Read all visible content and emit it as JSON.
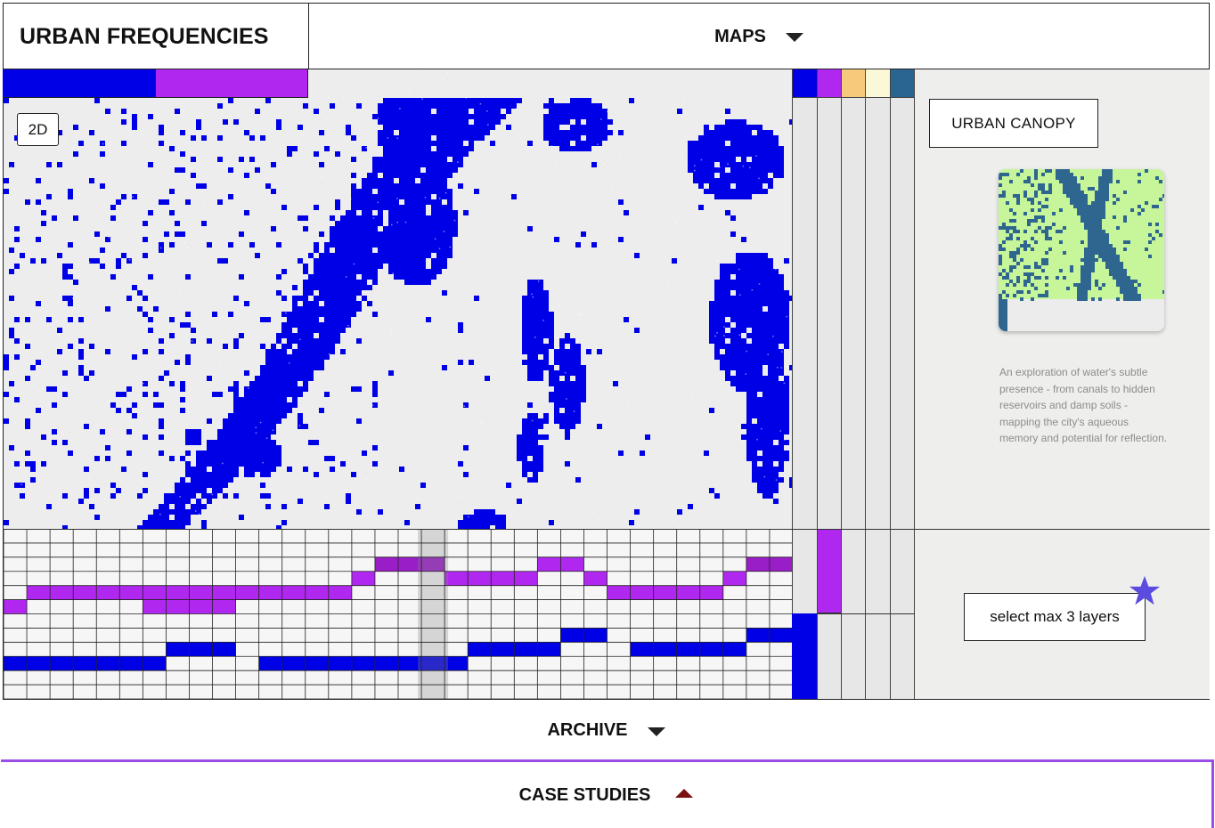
{
  "header": {
    "brand": "URBAN FREQUENCIES",
    "nav_maps_label": "MAPS"
  },
  "map": {
    "mode_label": "2D",
    "water_color": "#0000e6",
    "background_color": "#ededed",
    "layer_tabs": [
      {
        "name": "water",
        "color": "#0000e6",
        "active": true
      },
      {
        "name": "purple",
        "color": "#b027f0",
        "active": true
      }
    ]
  },
  "layer_strips": [
    {
      "color": "#0000e6"
    },
    {
      "color": "#b027f0"
    },
    {
      "color": "#f7c97a"
    },
    {
      "color": "#fbf8d8"
    },
    {
      "color": "#2a6592"
    }
  ],
  "panel": {
    "layer_button": "URBAN CANOPY",
    "thumbnail_colors": {
      "land": "#c6f59a",
      "water": "#2e6690"
    },
    "description": "An exploration of water's subtle presence - from canals to hidden reservoirs and damp soils - mapping the city's aqueous memory and potential for reflection.",
    "select_hint": "select max 3 layers",
    "star_color": "#5b4be0"
  },
  "timeline": {
    "columns": 34,
    "rows": 12,
    "highlight_column": 18,
    "purple": "#b027f0",
    "purple_dark": "#9a1ec8",
    "blue": "#0000e6"
  },
  "footer": {
    "archive_label": "ARCHIVE",
    "case_studies_label": "CASE STUDIES"
  }
}
